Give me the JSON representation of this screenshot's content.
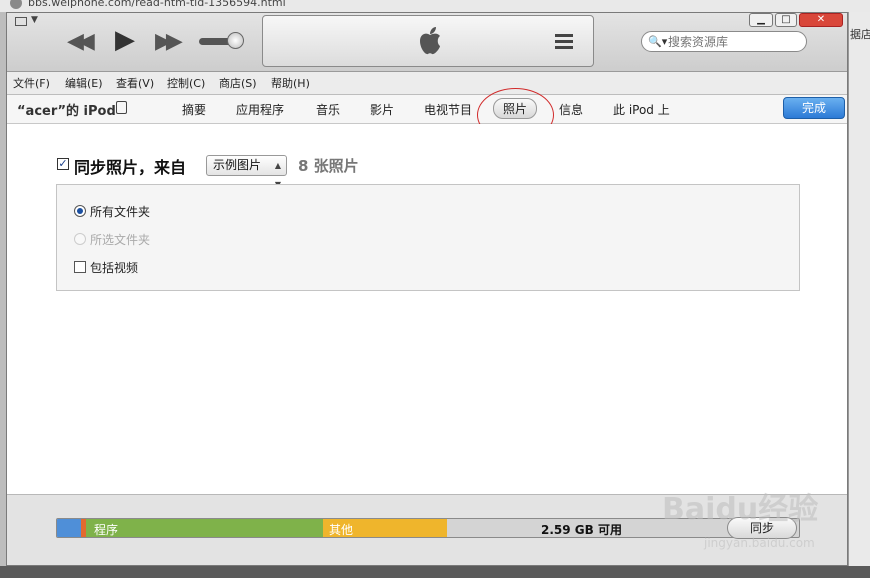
{
  "browser": {
    "url": "bbs.weiphone.com/read-htm-tid-1356594.html",
    "side_text": "据店铺"
  },
  "player": {
    "search_placeholder": "搜索资源库"
  },
  "menu": {
    "items": [
      "文件(F)",
      "编辑(E)",
      "查看(V)",
      "控制(C)",
      "商店(S)",
      "帮助(H)"
    ]
  },
  "device": {
    "name": "“acer”的 iPod"
  },
  "tabs": [
    "摘要",
    "应用程序",
    "音乐",
    "影片",
    "电视节目",
    "照片",
    "信息",
    "此 iPod 上"
  ],
  "active_tab": "照片",
  "done_label": "完成",
  "sync": {
    "label": "同步照片，来自",
    "checked": true,
    "source": "示例图片",
    "count_label": "8 张照片"
  },
  "options": {
    "all_folders": "所有文件夹",
    "selected_folders": "所选文件夹",
    "include_videos": "包括视频",
    "all_folders_selected": true,
    "selected_folders_disabled": true,
    "include_videos_checked": false
  },
  "capacity": {
    "segments": [
      {
        "label": "",
        "color": "#4f8fd8"
      },
      {
        "label": "",
        "color": "#e36a2f"
      },
      {
        "label": "程序",
        "color": "#7fb24a"
      },
      {
        "label": "其他",
        "color": "#efb52c"
      }
    ],
    "free_label": "2.59 GB 可用"
  },
  "sync_button_label": "同步",
  "watermark": {
    "text": "Baidu经验",
    "sub": "jingyan.baidu.com"
  },
  "colors": {
    "accent": "#2c7ad6",
    "annotation": "#d12a2a"
  }
}
